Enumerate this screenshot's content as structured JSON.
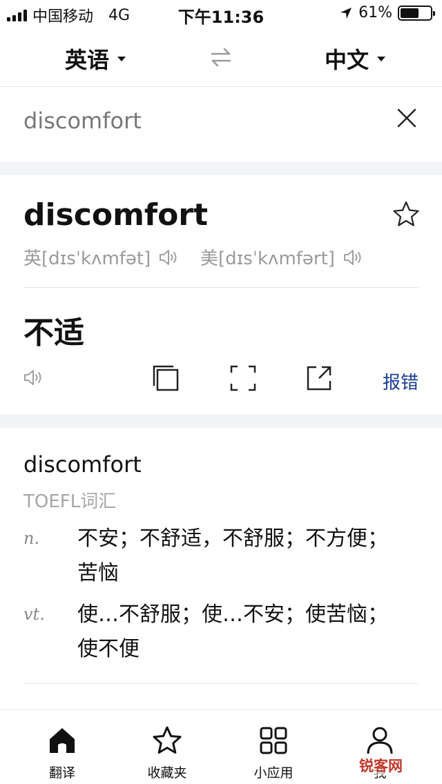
{
  "status_bar": {
    "carrier": "中国移动",
    "network": "4G",
    "time": "下午11:36",
    "battery": "61%",
    "battery_level": 0.61
  },
  "header": {
    "source_lang": "英语",
    "target_lang": "中文"
  },
  "search": {
    "query": "discomfort"
  },
  "word_card": {
    "headword": "discomfort",
    "uk_phonetic": "英[dɪsˈkʌmfət]",
    "us_phonetic": "美[dɪsˈkʌmfərt]",
    "translation": "不适",
    "report_label": "报错"
  },
  "dictionary": {
    "word": "discomfort",
    "tag": "TOEFL词汇",
    "entries": [
      {
        "pos": "n.",
        "definition": "不安；不舒适，不舒服；不方便；苦恼"
      },
      {
        "pos": "vt.",
        "definition": "使…不舒服；使…不安；使苦恼；使不便"
      }
    ]
  },
  "bottom_nav": {
    "items": [
      {
        "label": "翻译"
      },
      {
        "label": "收藏夹"
      },
      {
        "label": "小应用"
      },
      {
        "label": "我"
      }
    ]
  },
  "watermark": "锐客网",
  "colors": {
    "link": "#1d3f94",
    "muted": "#9a9a9a",
    "band": "#f3f4f6"
  }
}
